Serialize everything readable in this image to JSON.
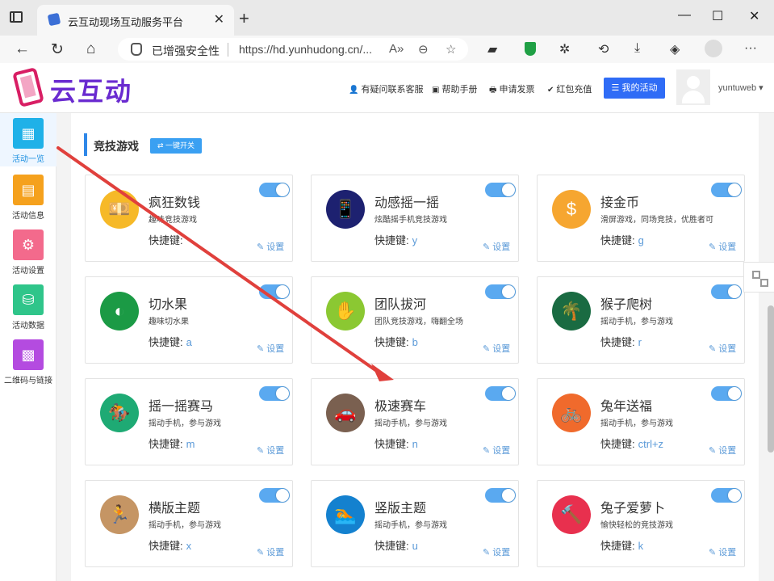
{
  "browser": {
    "tab_title": "云互动现场互动服务平台",
    "tab_close": "✕",
    "new_tab": "+",
    "security_label": "已增强安全性",
    "url": "https://hd.yunhudong.cn/..."
  },
  "site": {
    "logo_text": "云互动",
    "header_links": [
      {
        "icon": "👤",
        "label": "有疑问联系客服"
      },
      {
        "icon": "▣",
        "label": "帮助手册"
      },
      {
        "icon": "🖶",
        "label": "申请发票"
      },
      {
        "icon": "✔",
        "label": "红包充值"
      }
    ],
    "my_activity_btn": "☰ 我的活动",
    "username": "yuntuweb ▾"
  },
  "sidebar": {
    "items": [
      {
        "label": "活动一览",
        "color": "#1fb1e8",
        "glyph": "▦"
      },
      {
        "label": "活动信息",
        "color": "#f5a11d",
        "glyph": "▤"
      },
      {
        "label": "活动设置",
        "color": "#f36a8c",
        "glyph": "⚙"
      },
      {
        "label": "活动数据",
        "color": "#2fc58a",
        "glyph": "⛁"
      },
      {
        "label": "二维码与链接",
        "color": "#b44be0",
        "glyph": "▩"
      }
    ]
  },
  "section": {
    "title": "竞技游戏",
    "switch_all": "⇄ 一键开关"
  },
  "hotkey_label": "快捷键:",
  "settings_label": "✎ 设置",
  "games": [
    {
      "name": "疯狂数钱",
      "desc": "趣味竞技游戏",
      "hotkey": "",
      "color": "#f6b928",
      "icon": "coin-bag-icon",
      "glyph": "💴"
    },
    {
      "name": "动感摇一摇",
      "desc": "炫酷摇手机竞技游戏",
      "hotkey": "y",
      "color": "#1d2170",
      "icon": "phone-shake-icon",
      "glyph": "📱"
    },
    {
      "name": "接金币",
      "desc": "滑屏游戏，同场竞技，优胜者可",
      "hotkey": "g",
      "color": "#f6a630",
      "icon": "coin-stack-icon",
      "glyph": "$"
    },
    {
      "name": "切水果",
      "desc": "趣味切水果",
      "hotkey": "a",
      "color": "#1b9a45",
      "icon": "orange-icon",
      "glyph": "◐"
    },
    {
      "name": "团队拔河",
      "desc": "团队竞技游戏，嗨翻全场",
      "hotkey": "b",
      "color": "#8bc832",
      "icon": "tug-of-war-icon",
      "glyph": "✋"
    },
    {
      "name": "猴子爬树",
      "desc": "摇动手机，参与游戏",
      "hotkey": "r",
      "color": "#1a6b42",
      "icon": "palm-tree-icon",
      "glyph": "🌴"
    },
    {
      "name": "摇一摇赛马",
      "desc": "摇动手机，参与游戏",
      "hotkey": "m",
      "color": "#1eaa74",
      "icon": "horse-rider-icon",
      "glyph": "🏇"
    },
    {
      "name": "极速赛车",
      "desc": "摇动手机，参与游戏",
      "hotkey": "n",
      "color": "#7a6050",
      "icon": "car-icon",
      "glyph": "🚗"
    },
    {
      "name": "兔年送福",
      "desc": "摇动手机，参与游戏",
      "hotkey": "ctrl+z",
      "color": "#f06a2c",
      "icon": "bicycle-icon",
      "glyph": "🚲"
    },
    {
      "name": "横版主题",
      "desc": "摇动手机，参与游戏",
      "hotkey": "x",
      "color": "#c59564",
      "icon": "runner-icon",
      "glyph": "🏃"
    },
    {
      "name": "竖版主题",
      "desc": "摇动手机，参与游戏",
      "hotkey": "u",
      "color": "#1481cf",
      "icon": "swimmer-icon",
      "glyph": "🏊"
    },
    {
      "name": "兔子爱萝卜",
      "desc": "愉快轻松的竞技游戏",
      "hotkey": "k",
      "color": "#e8304e",
      "icon": "hammer-icon",
      "glyph": "🔨"
    }
  ]
}
